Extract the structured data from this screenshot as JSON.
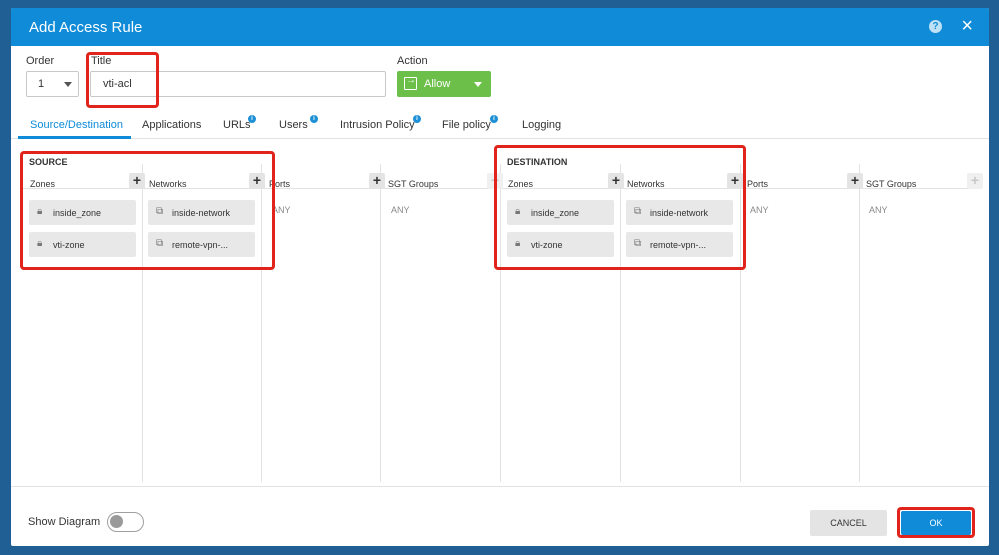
{
  "dialog": {
    "title": "Add Access Rule",
    "help_icon": "?",
    "close_icon": "×"
  },
  "form": {
    "order_label": "Order",
    "order_value": "1",
    "title_label": "Title",
    "title_value": "vti-acl",
    "action_label": "Action",
    "action_value": "Allow",
    "action_color": "#6cc04a"
  },
  "tabs": [
    {
      "label": "Source/Destination",
      "active": true
    },
    {
      "label": "Applications"
    },
    {
      "label": "URLs",
      "info": true
    },
    {
      "label": "Users",
      "info": true
    },
    {
      "label": "Intrusion Policy",
      "info": true
    },
    {
      "label": "File policy",
      "info": true
    },
    {
      "label": "Logging"
    }
  ],
  "source": {
    "title": "SOURCE",
    "zones_label": "Zones",
    "networks_label": "Networks",
    "ports_label": "Ports",
    "sgt_label": "SGT Groups",
    "zones": [
      "inside_zone",
      "vti-zone"
    ],
    "networks": [
      "inside-network",
      "remote-vpn-..."
    ],
    "ports_value": "ANY",
    "sgt_value": "ANY"
  },
  "destination": {
    "title": "DESTINATION",
    "zones_label": "Zones",
    "networks_label": "Networks",
    "ports_label": "Ports",
    "sgt_label": "SGT Groups",
    "zones": [
      "inside_zone",
      "vti-zone"
    ],
    "networks": [
      "inside-network",
      "remote-vpn-..."
    ],
    "ports_value": "ANY",
    "sgt_value": "ANY"
  },
  "footer": {
    "show_diagram_label": "Show Diagram",
    "show_diagram_on": false,
    "cancel_label": "CANCEL",
    "ok_label": "OK"
  },
  "colors": {
    "accent": "#0f8bd7",
    "highlight": "#e0231b"
  }
}
